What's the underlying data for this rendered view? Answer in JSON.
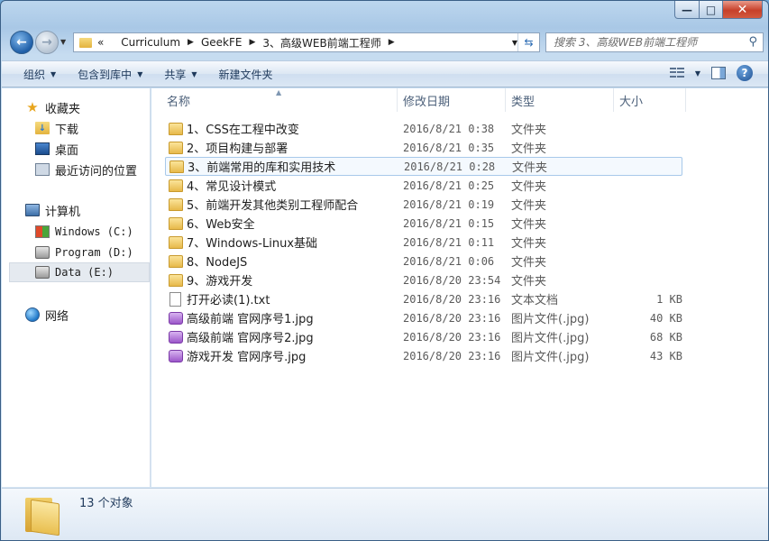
{
  "window": {
    "caption": {
      "minimize": "—",
      "maximize": "□",
      "close": "✕"
    }
  },
  "address": {
    "overflow": "«",
    "crumbs": [
      "Curriculum",
      "GeekFE",
      "3、高级WEB前端工程师"
    ],
    "search_placeholder": "搜索 3、高级WEB前端工程师"
  },
  "toolbar": {
    "organize": "组织",
    "include_in_library": "包含到库中",
    "share": "共享",
    "new_folder": "新建文件夹"
  },
  "sidebar": {
    "favorites": "收藏夹",
    "downloads": "下载",
    "desktop": "桌面",
    "recent": "最近访问的位置",
    "computer": "计算机",
    "drive_c": "Windows (C:)",
    "drive_d": "Program (D:)",
    "drive_e": "Data (E:)",
    "network": "网络"
  },
  "columns": {
    "name": "名称",
    "date": "修改日期",
    "type": "类型",
    "size": "大小"
  },
  "files": [
    {
      "name": "1、CSS在工程中改变",
      "date": "2016/8/21 0:38",
      "type": "文件夹",
      "size": "",
      "kind": "folder"
    },
    {
      "name": "2、项目构建与部署",
      "date": "2016/8/21 0:35",
      "type": "文件夹",
      "size": "",
      "kind": "folder"
    },
    {
      "name": "3、前端常用的库和实用技术",
      "date": "2016/8/21 0:28",
      "type": "文件夹",
      "size": "",
      "kind": "folder"
    },
    {
      "name": "4、常见设计模式",
      "date": "2016/8/21 0:25",
      "type": "文件夹",
      "size": "",
      "kind": "folder"
    },
    {
      "name": "5、前端开发其他类别工程师配合",
      "date": "2016/8/21 0:19",
      "type": "文件夹",
      "size": "",
      "kind": "folder"
    },
    {
      "name": "6、Web安全",
      "date": "2016/8/21 0:15",
      "type": "文件夹",
      "size": "",
      "kind": "folder"
    },
    {
      "name": "7、Windows-Linux基础",
      "date": "2016/8/21 0:11",
      "type": "文件夹",
      "size": "",
      "kind": "folder"
    },
    {
      "name": "8、NodeJS",
      "date": "2016/8/21 0:06",
      "type": "文件夹",
      "size": "",
      "kind": "folder"
    },
    {
      "name": "9、游戏开发",
      "date": "2016/8/20 23:54",
      "type": "文件夹",
      "size": "",
      "kind": "folder"
    },
    {
      "name": "打开必读(1).txt",
      "date": "2016/8/20 23:16",
      "type": "文本文档",
      "size": "1 KB",
      "kind": "txt"
    },
    {
      "name": "高级前端 官网序号1.jpg",
      "date": "2016/8/20 23:16",
      "type": "图片文件(.jpg)",
      "size": "40 KB",
      "kind": "jpg"
    },
    {
      "name": "高级前端 官网序号2.jpg",
      "date": "2016/8/20 23:16",
      "type": "图片文件(.jpg)",
      "size": "68 KB",
      "kind": "jpg"
    },
    {
      "name": "游戏开发 官网序号.jpg",
      "date": "2016/8/20 23:16",
      "type": "图片文件(.jpg)",
      "size": "43 KB",
      "kind": "jpg"
    }
  ],
  "details": {
    "count": "13 个对象"
  }
}
